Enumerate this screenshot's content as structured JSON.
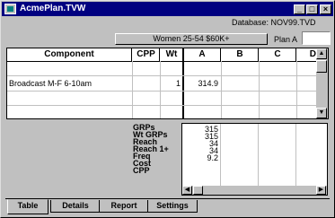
{
  "window": {
    "title": "AcmePlan.TVW"
  },
  "header": {
    "database_label": "Database: NOV99.TVD",
    "demo_button": "Women 25-54 $60K+",
    "plan_label": "Plan A",
    "plan_value": ""
  },
  "grid": {
    "columns": [
      "Component",
      "CPP",
      "Wt",
      "A",
      "B",
      "C",
      "D"
    ],
    "rows": [
      {
        "component": "",
        "cpp": "",
        "wt": "",
        "a": ""
      },
      {
        "component": "Broadcast M-F 6-10am",
        "cpp": "",
        "wt": "1",
        "a": "314.9"
      },
      {
        "component": "",
        "cpp": "",
        "wt": "",
        "a": ""
      }
    ]
  },
  "summary": {
    "metrics": [
      {
        "label": "GRPs",
        "value": "315"
      },
      {
        "label": "Wt GRPs",
        "value": "315"
      },
      {
        "label": "Reach",
        "value": "34"
      },
      {
        "label": "Reach 1+",
        "value": "34"
      },
      {
        "label": "Freq",
        "value": "9.2"
      },
      {
        "label": "Cost",
        "value": ""
      },
      {
        "label": "CPP",
        "value": ""
      }
    ]
  },
  "tabs": [
    "Table",
    "Details",
    "Report",
    "Settings"
  ],
  "icons": {
    "minimize": "minimize-icon",
    "maximize": "maximize-icon",
    "close": "close-icon",
    "app": "app-icon"
  }
}
